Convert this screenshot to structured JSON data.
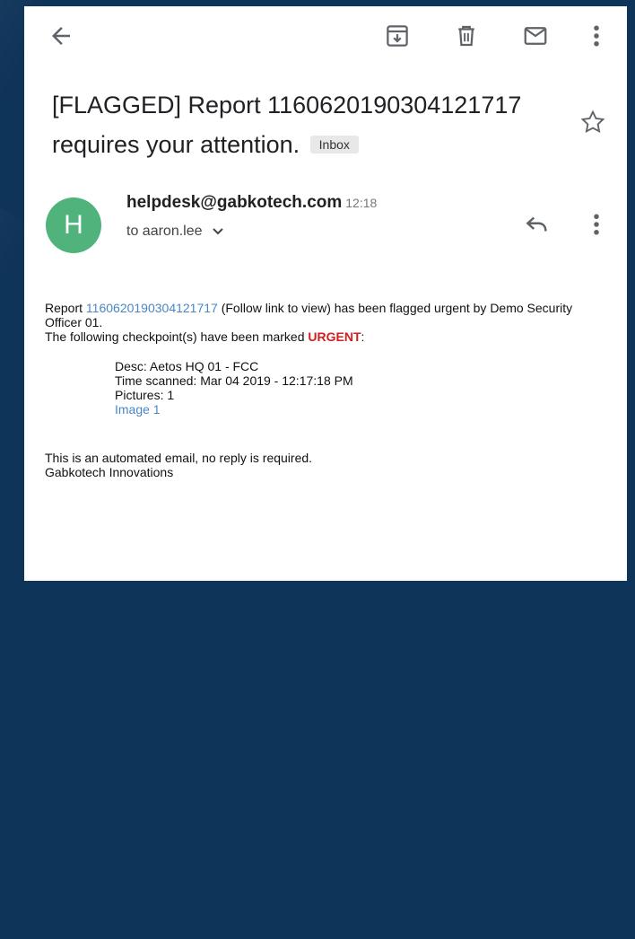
{
  "email": {
    "subject": "[FLAGGED] Report 11606201903041217­17 requires your attention.",
    "label": "Inbox",
    "sender_initial": "H",
    "sender": "helpdesk@gabkotech.com",
    "time": "12:18",
    "to": "to aaron.lee"
  },
  "body": {
    "line1_prefix": "Report ",
    "report_link": "1160620190304121717",
    "line1_suffix": " (Follow link to view) has been flagged urgent by Demo Security Officer 01.",
    "line2_prefix": "The following checkpoint(s) have been marked ",
    "urgent_word": "URGENT",
    "line2_suffix": ":",
    "desc": "Desc: Aetos HQ 01 - FCC",
    "time_scanned": "Time scanned: Mar 04 2019 - 12:17:18 PM",
    "pictures": "Pictures: 1",
    "image_link": "Image 1",
    "footer1": "This is an automated email, no reply is required.",
    "footer2": "Gabkotech Innovations"
  },
  "icons": [
    "back-arrow-icon",
    "archive-icon",
    "delete-icon",
    "mail-icon",
    "more-vert-icon",
    "star-icon",
    "reply-icon",
    "chevron-down-icon"
  ],
  "colors": {
    "avatar": "#4fb37b",
    "link": "#4a86c5",
    "urgent": "#d11f1f",
    "background": "#0f3459"
  }
}
